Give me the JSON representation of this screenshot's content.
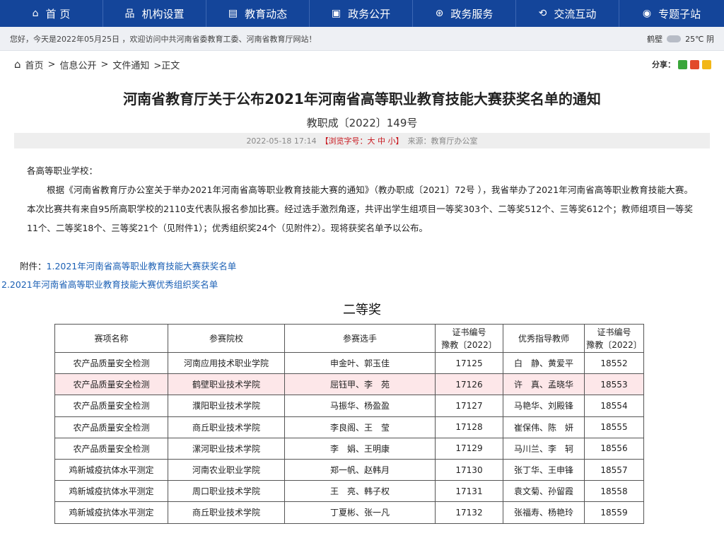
{
  "nav": [
    {
      "label": "首 页",
      "icon": "home-icon",
      "glyph": "⌂"
    },
    {
      "label": "机构设置",
      "icon": "org-chart-icon",
      "glyph": "品"
    },
    {
      "label": "教育动态",
      "icon": "news-icon",
      "glyph": "▤"
    },
    {
      "label": "政务公开",
      "icon": "document-icon",
      "glyph": "▣"
    },
    {
      "label": "政务服务",
      "icon": "service-icon",
      "glyph": "⊛"
    },
    {
      "label": "交流互动",
      "icon": "interaction-icon",
      "glyph": "⟲"
    },
    {
      "label": "专题子站",
      "icon": "eye-icon",
      "glyph": "◉"
    }
  ],
  "welcome": {
    "text": "您好，今天是2022年05月25日 ，欢迎访问中共河南省委教育工委、河南省教育厅网站！",
    "city": "鹤壁",
    "temp": "25℃ 阴"
  },
  "breadcrumb": {
    "items": [
      "首页",
      "信息公开",
      "文件通知"
    ],
    "sep": ">",
    "current": ">正文"
  },
  "share": {
    "label": "分享："
  },
  "article": {
    "title": "河南省教育厅关于公布2021年河南省高等职业教育技能大赛获奖名单的通知",
    "docnum": "教职成〔2022〕149号",
    "date": "2022-05-18 17:14",
    "fontsize": "【浏览字号：大 中 小】",
    "source": "来源：教育厅办公室",
    "salutation": "各高等职业学校：",
    "paragraph": "根据《河南省教育厅办公室关于举办2021年河南省高等职业教育技能大赛的通知》（教办职成〔2021〕72号 ），我省举办了2021年河南省高等职业教育技能大赛。本次比赛共有来自95所高职学校的2110支代表队报名参加比赛。经过选手激烈角逐，共评出学生组项目一等奖303个、二等奖512个、三等奖612个；教师组项目一等奖11个、二等奖18个、三等奖21个（见附件1）；优秀组织奖24个（见附件2）。现将获奖名单予以公布。",
    "attach_label": "附件：",
    "attach1": "1.2021年河南省高等职业教育技能大赛获奖名单",
    "attach2": "2.2021年河南省高等职业教育技能大赛优秀组织奖名单"
  },
  "table": {
    "section_title": "二等奖",
    "headers": {
      "event": "赛项名称",
      "school": "参赛院校",
      "players": "参赛选手",
      "cert1_a": "证书编号",
      "cert1_b": "豫教〔2022〕",
      "teachers": "优秀指导教师",
      "cert2_a": "证书编号",
      "cert2_b": "豫教〔2022〕"
    },
    "rows": [
      [
        "农产品质量安全检测",
        "河南应用技术职业学院",
        "申金叶、郭玉佳",
        "17125",
        "白　静、黄爱平",
        "18552"
      ],
      [
        "农产品质量安全检测",
        "鹤壁职业技术学院",
        "屈钰甲、李　苑",
        "17126",
        "许　真、孟晓华",
        "18553"
      ],
      [
        "农产品质量安全检测",
        "濮阳职业技术学院",
        "马振华、杨盈盈",
        "17127",
        "马艳华、刘殿锋",
        "18554"
      ],
      [
        "农产品质量安全检测",
        "商丘职业技术学院",
        "李良阁、王　莹",
        "17128",
        "崔保伟、陈　妍",
        "18555"
      ],
      [
        "农产品质量安全检测",
        "漯河职业技术学院",
        "李　娟、王明康",
        "17129",
        "马川兰、李　轲",
        "18556"
      ],
      [
        "鸡新城疫抗体水平测定",
        "河南农业职业学院",
        "郑一帆、赵韩月",
        "17130",
        "张丁华、王申锋",
        "18557"
      ],
      [
        "鸡新城疫抗体水平测定",
        "周口职业技术学院",
        "王　亮、韩子权",
        "17131",
        "袁文菊、孙留霞",
        "18558"
      ],
      [
        "鸡新城疫抗体水平测定",
        "商丘职业技术学院",
        "丁夏彬、张一凡",
        "17132",
        "张福寿、杨艳玲",
        "18559"
      ]
    ]
  }
}
